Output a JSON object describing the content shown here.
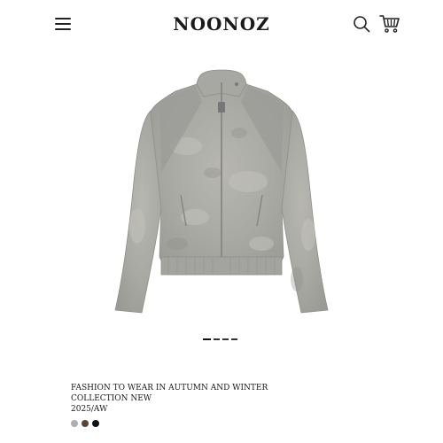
{
  "header": {
    "brand": "NOONOZ",
    "menu_icon": "hamburger-menu-icon",
    "search_icon": "search-icon",
    "cart_icon": "shopping-cart-icon"
  },
  "product": {
    "image_alt": "grey suede-look zip-up jacket with stand collar",
    "title_line1": "FASHION TO WEAR IN AUTUMN AND WINTER",
    "title_line2": "COLLECTION NEW",
    "season": "2025/AW",
    "colors": [
      "#aeaeae",
      "#5b4437",
      "#111111"
    ]
  },
  "carousel": {
    "total": 4,
    "active": 0
  }
}
